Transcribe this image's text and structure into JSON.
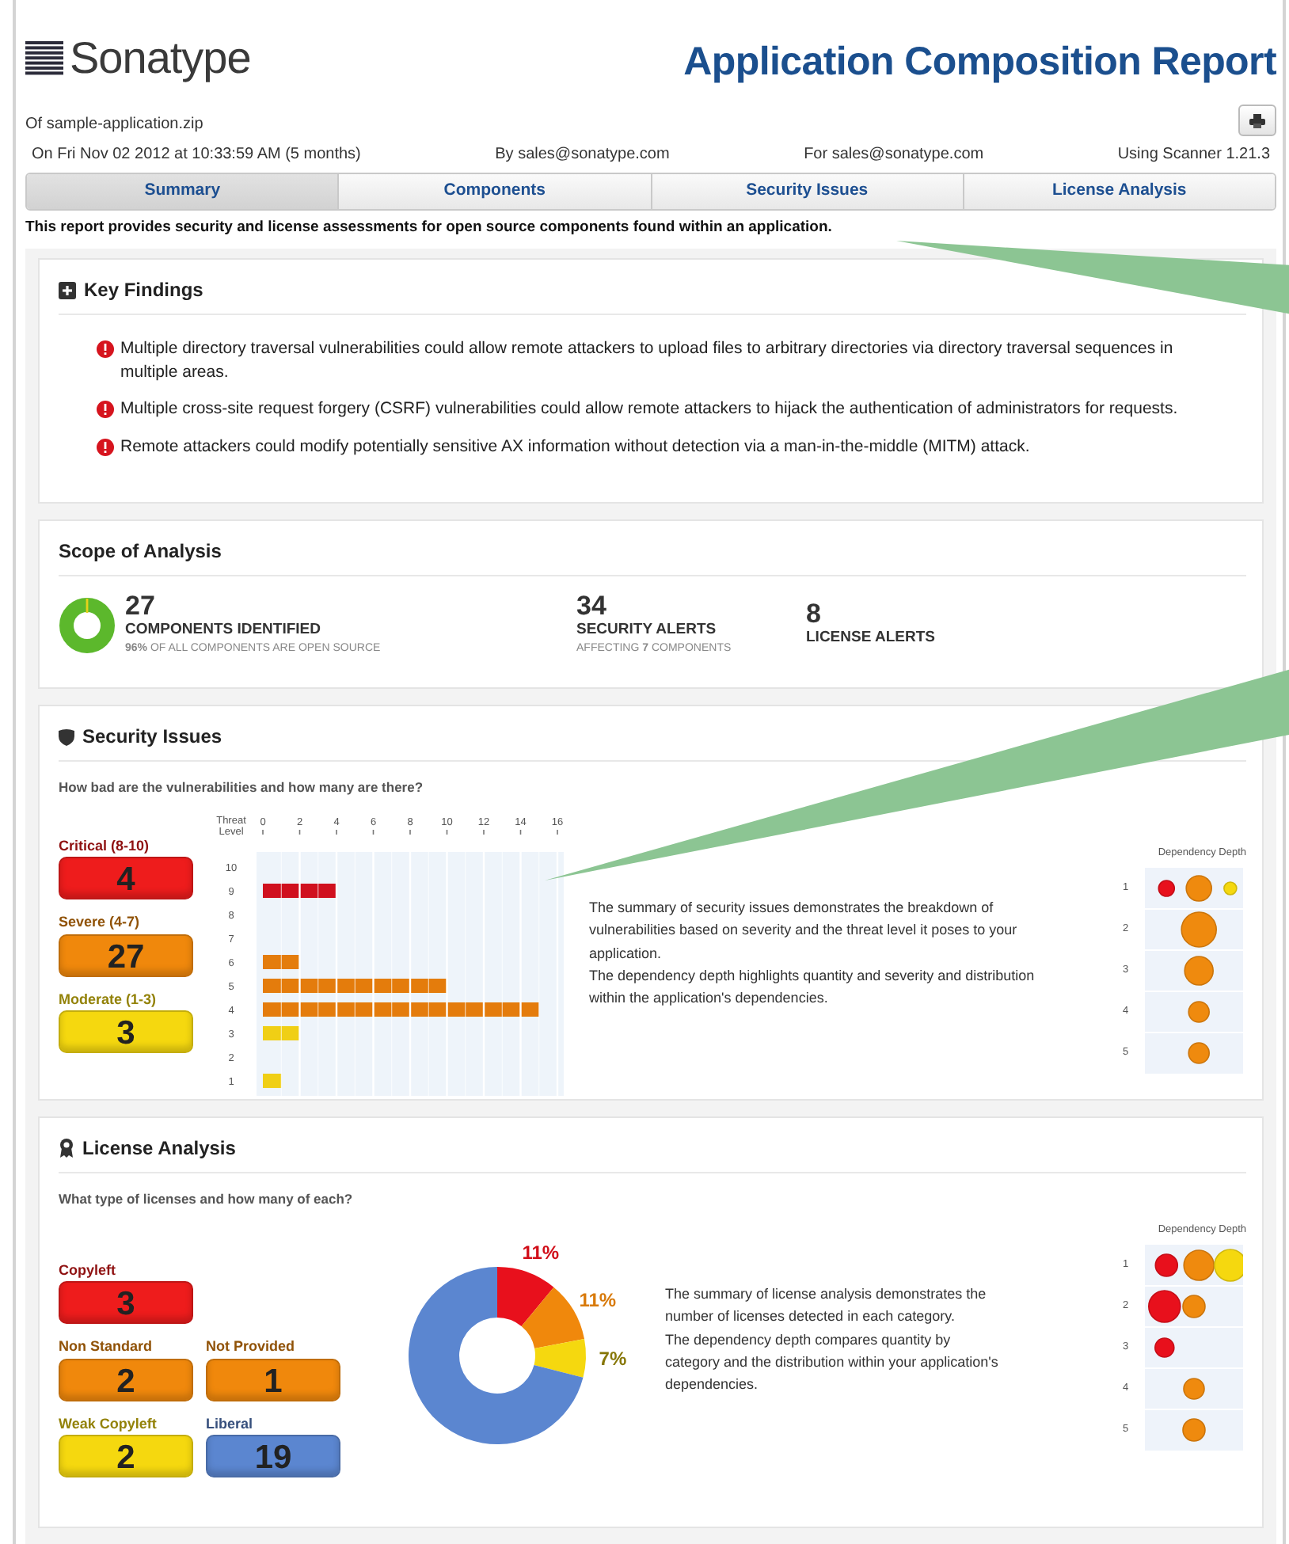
{
  "header": {
    "logo": "Sonatype",
    "title": "Application Composition Report",
    "file": "Of sample-application.zip",
    "meta": [
      "On Fri Nov 02 2012 at 10:33:59 AM (5 months)",
      "By sales@sonatype.com",
      "For sales@sonatype.com",
      "Using Scanner 1.21.3"
    ]
  },
  "tabs": [
    {
      "label": "Summary",
      "selected": true
    },
    {
      "label": "Components",
      "selected": false
    },
    {
      "label": "Security Issues",
      "selected": false
    },
    {
      "label": "License Analysis",
      "selected": false
    }
  ],
  "intro": "This report provides security and license assessments for open source components found within an application.",
  "key_findings": {
    "title": "Key Findings",
    "items": [
      "Multiple directory traversal vulnerabilities could allow remote attackers to upload files to arbitrary directories via directory traversal sequences in multiple areas.",
      "Multiple cross-site request forgery (CSRF) vulnerabilities could allow remote attackers to hijack the authentication of administrators for requests.",
      "Remote attackers could modify potentially sensitive AX information without detection via a man-in-the-middle (MITM) attack."
    ]
  },
  "scope": {
    "title": "Scope of Analysis",
    "stats": [
      {
        "value": "27",
        "label": "COMPONENTS IDENTIFIED",
        "note": "**96%** OF ALL COMPONENTS ARE OPEN SOURCE"
      },
      {
        "value": "34",
        "label": "SECURITY ALERTS",
        "note": "AFFECTING **7** COMPONENTS"
      },
      {
        "value": "8",
        "label": "LICENSE ALERTS"
      }
    ]
  },
  "security": {
    "title": "Security Issues",
    "question": "How bad are the vulnerabilities and how many are there?",
    "severities": [
      {
        "label": "Critical (8-10)",
        "count": "4",
        "color": "#ee1c1c"
      },
      {
        "label": "Severe (4-7)",
        "count": "27",
        "color": "#f0880c"
      },
      {
        "label": "Moderate (1-3)",
        "count": "3",
        "color": "#f5d80f"
      }
    ],
    "chart_data": {
      "type": "bar",
      "orientation": "horizontal",
      "ylabel": "Threat Level",
      "categories": [
        "10",
        "9",
        "8",
        "7",
        "6",
        "5",
        "4",
        "3",
        "2",
        "1"
      ],
      "xlim": [
        0,
        16
      ],
      "xticks": [
        0,
        2,
        4,
        6,
        8,
        10,
        12,
        14,
        16
      ],
      "grid": true,
      "series": [
        {
          "color": "#d0101e",
          "values": [
            null,
            4,
            null,
            null,
            null,
            null,
            null,
            null,
            null,
            null
          ]
        },
        {
          "color": "#e47c0c",
          "values": [
            null,
            null,
            null,
            null,
            2,
            10,
            15,
            null,
            null,
            null
          ]
        },
        {
          "color": "#f0cf15",
          "values": [
            null,
            null,
            null,
            null,
            null,
            null,
            null,
            2,
            null,
            1
          ]
        }
      ]
    },
    "description": [
      "The summary of security issues demonstrates the breakdown of vulnerabilities based on severity and the threat level it poses to your application.",
      "The dependency depth highlights quantity and severity and distribution within the application's dependencies."
    ],
    "depth": {
      "title": "Dependency Depth",
      "levels": [
        "1",
        "2",
        "3",
        "4",
        "5"
      ]
    }
  },
  "license": {
    "title": "License Analysis",
    "question": "What type of licenses and how many of each?",
    "tile_rows": [
      [
        {
          "label": "Copyleft",
          "count": "3",
          "color": "#ee1c1c"
        }
      ],
      [
        {
          "label": "Non Standard",
          "count": "2",
          "color": "#f0880c"
        },
        {
          "label": "Not Provided",
          "count": "1",
          "color": "#f0880c"
        }
      ],
      [
        {
          "label": "Weak Copyleft",
          "count": "2",
          "color": "#f5d80f"
        },
        {
          "label": "Liberal",
          "count": "19",
          "color": "#5b86d0"
        }
      ]
    ],
    "chart_data": {
      "type": "donut",
      "values": [
        11,
        11,
        7,
        71
      ],
      "value_labels": [
        "11%",
        "11%",
        "7%",
        null
      ],
      "colors": [
        "#e8101c",
        "#f0880c",
        "#f5d80f",
        "#5b86d0"
      ]
    },
    "description": [
      "The summary of license analysis demonstrates the number of licenses detected in each category.",
      "The dependency depth compares quantity by category and the distribution within your application's dependencies."
    ],
    "depth": {
      "title": "Dependency Depth",
      "levels": [
        "1",
        "2",
        "3",
        "4",
        "5"
      ]
    }
  }
}
